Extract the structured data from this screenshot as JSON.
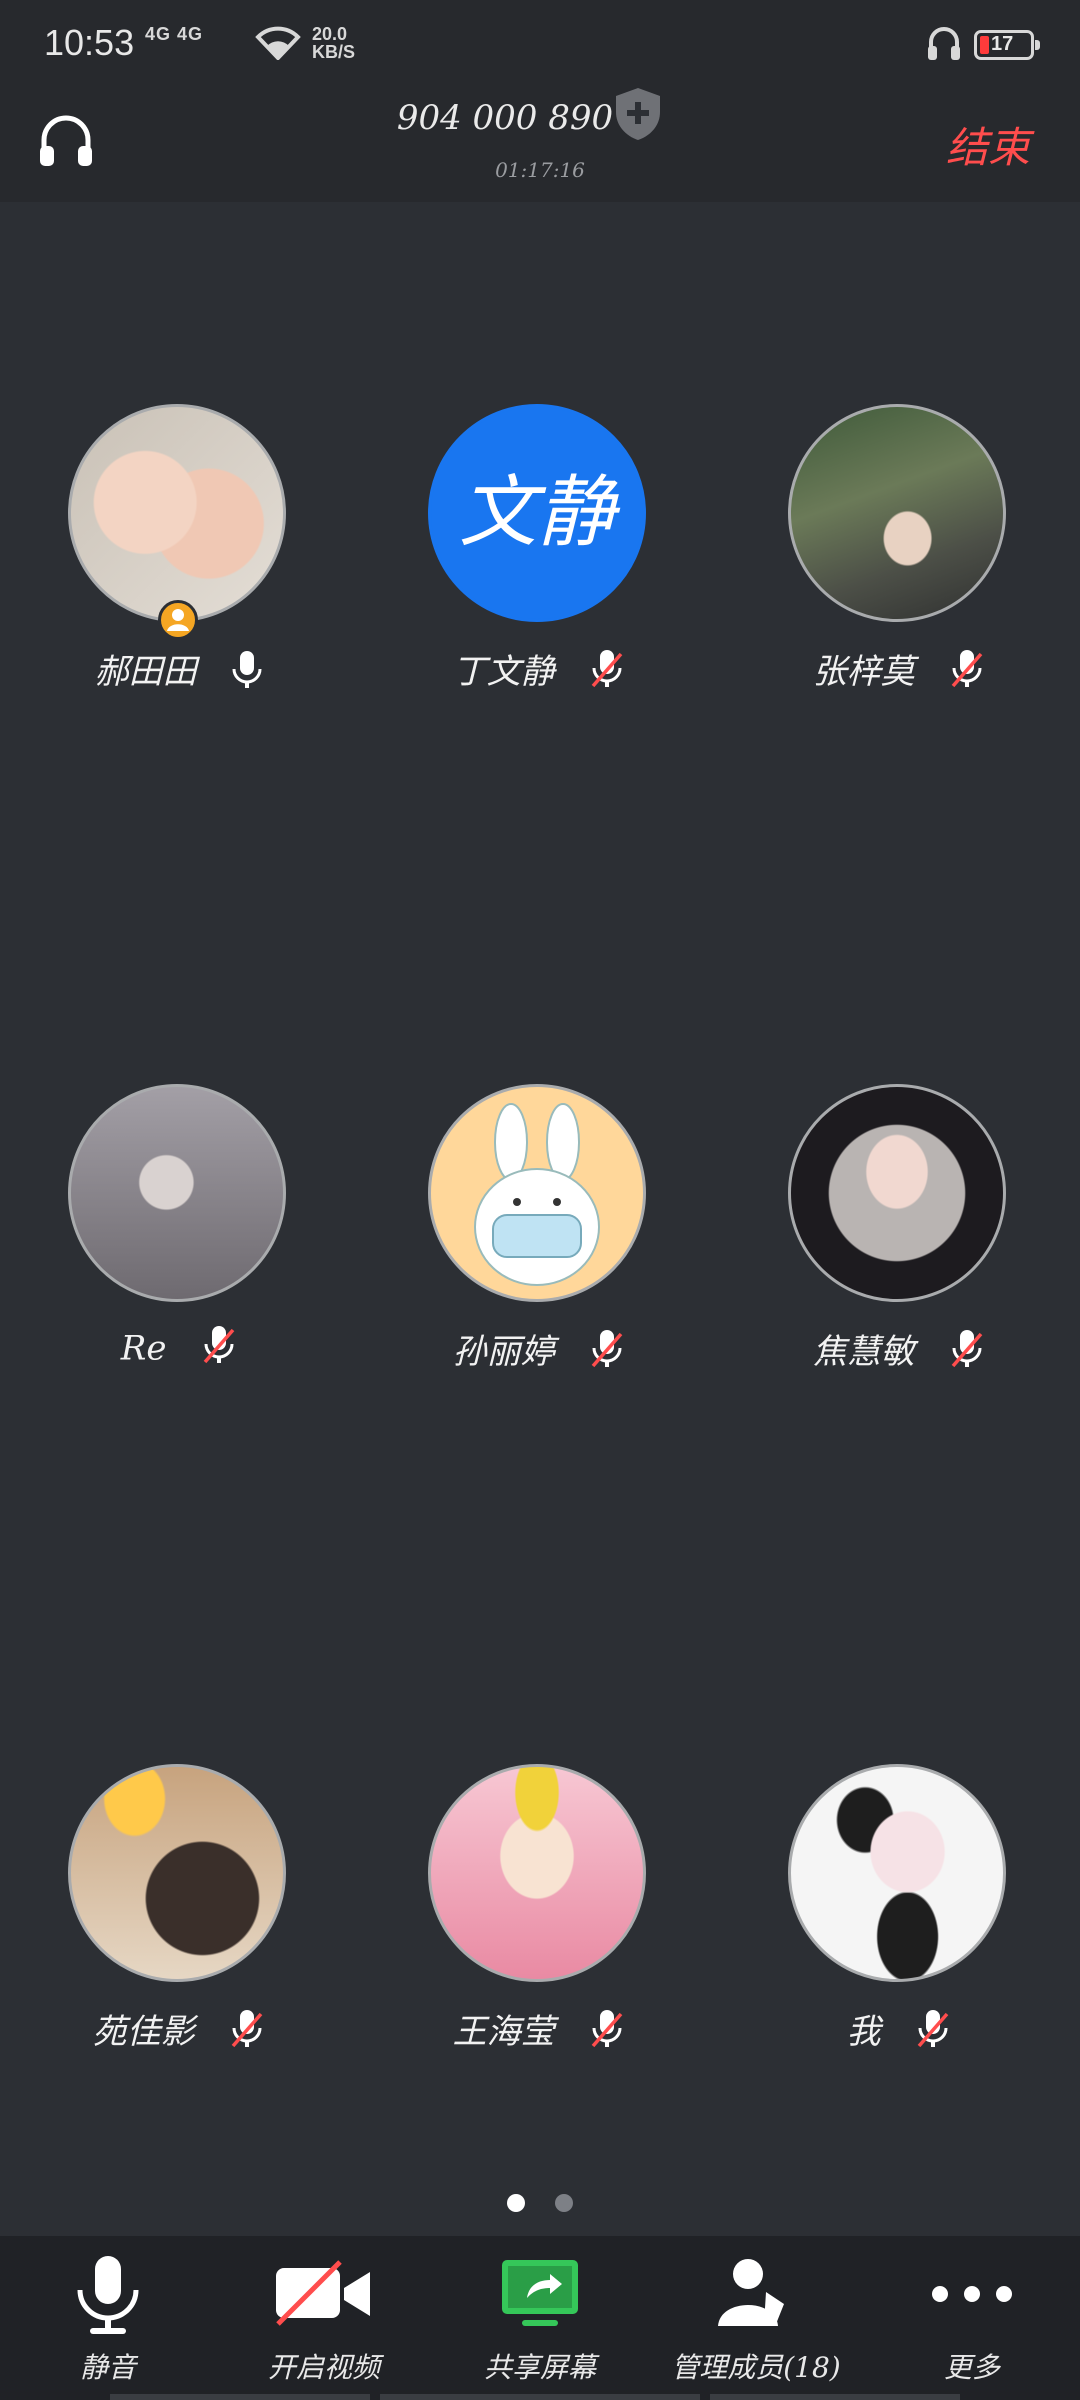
{
  "status_bar": {
    "time": "10:53",
    "network": "4G 4G",
    "speed_value": "20.0",
    "speed_unit": "KB/S",
    "battery": "17"
  },
  "header": {
    "meeting_id": "904 000 890",
    "elapsed": "01:17:16",
    "end_label": "结束"
  },
  "participants": [
    {
      "name": "郝田田",
      "avatar_text": "",
      "avatar_color": "#c9c1b6",
      "muted": false,
      "host": true
    },
    {
      "name": "丁文静",
      "avatar_text": "文静",
      "avatar_color": "#1976f0",
      "muted": true,
      "host": false
    },
    {
      "name": "张梓莫",
      "avatar_text": "",
      "avatar_color": "#5c6a4c",
      "muted": true,
      "host": false
    },
    {
      "name": "Re",
      "avatar_text": "",
      "avatar_color": "#8f8c92",
      "muted": true,
      "host": false
    },
    {
      "name": "孙丽婷",
      "avatar_text": "",
      "avatar_color": "#ffd79a",
      "muted": true,
      "host": false
    },
    {
      "name": "焦慧敏",
      "avatar_text": "",
      "avatar_color": "#1d1b1f",
      "muted": true,
      "host": false
    },
    {
      "name": "苑佳影",
      "avatar_text": "",
      "avatar_color": "#c7a37e",
      "muted": true,
      "host": false
    },
    {
      "name": "王海莹",
      "avatar_text": "",
      "avatar_color": "#f3b6c4",
      "muted": true,
      "host": false
    },
    {
      "name": "我",
      "avatar_text": "",
      "avatar_color": "#f1f1f1",
      "muted": true,
      "host": false
    }
  ],
  "pager": {
    "current": 1,
    "total": 2
  },
  "toolbar": {
    "mute_label": "静音",
    "video_label": "开启视频",
    "share_label": "共享屏幕",
    "members_label": "管理成员(18)",
    "more_label": "更多"
  },
  "colors": {
    "accent_red": "#ff4d4d",
    "share_green": "#35c759",
    "host_badge": "#f5a623"
  }
}
